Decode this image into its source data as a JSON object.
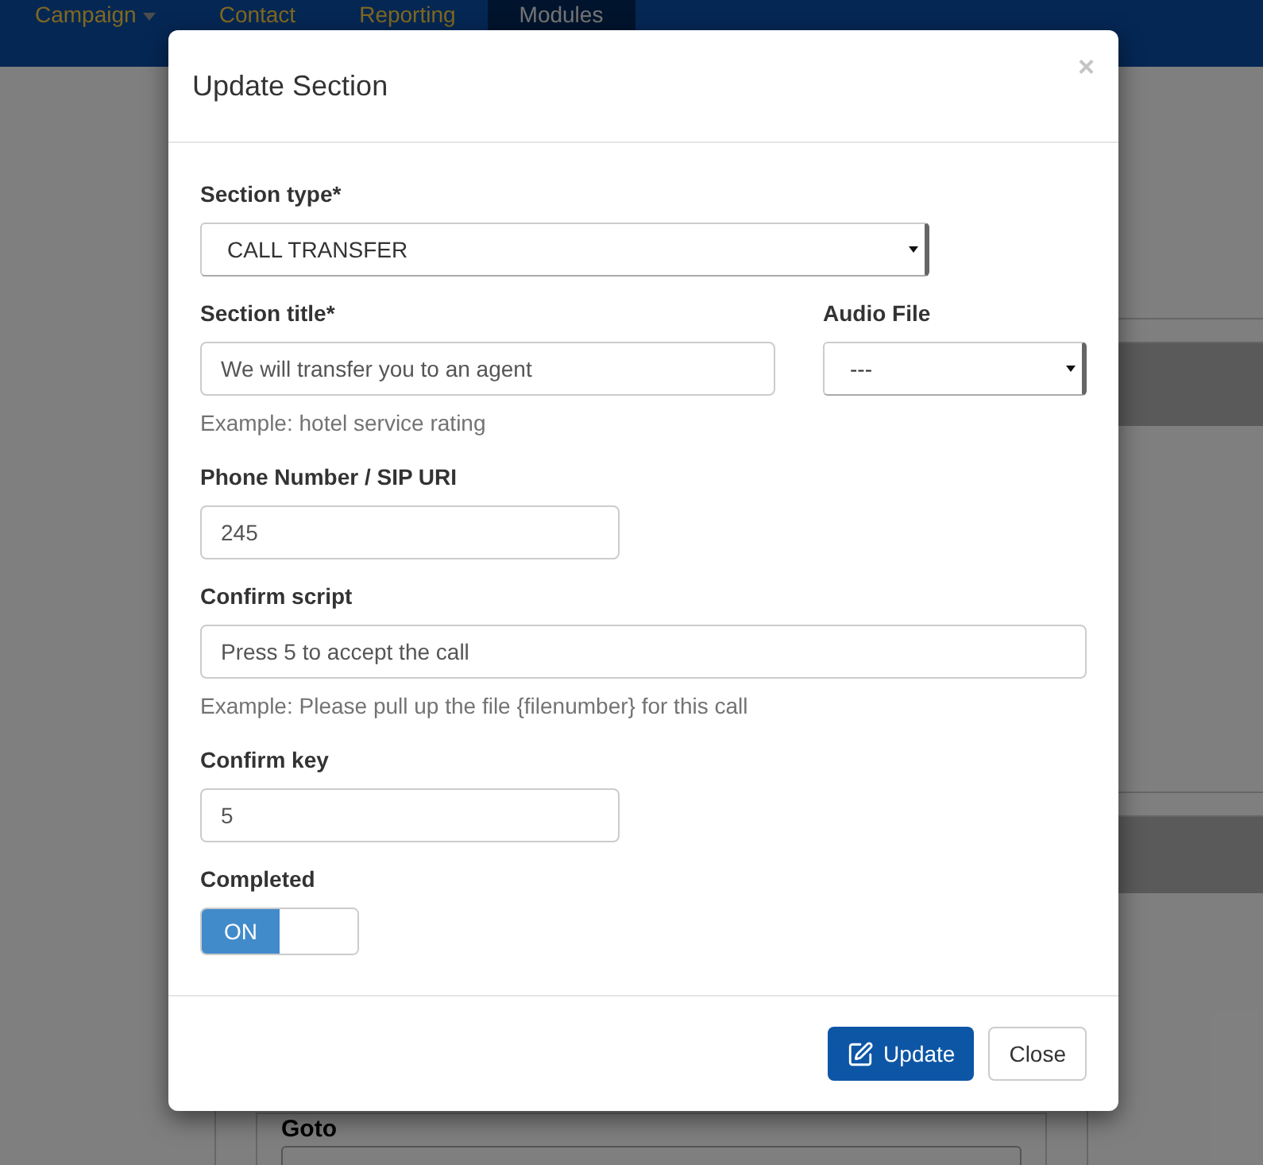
{
  "navbar": {
    "items": [
      {
        "label": "Campaign",
        "has_caret": true,
        "selected": false
      },
      {
        "label": "Contact",
        "has_caret": false,
        "selected": false
      },
      {
        "label": "Reporting",
        "has_caret": false,
        "selected": false
      },
      {
        "label": "Modules",
        "has_caret": false,
        "selected": true
      }
    ]
  },
  "background": {
    "panel_label": "Goto"
  },
  "modal": {
    "title": "Update Section",
    "close": "×",
    "rows": [
      [
        {
          "kind": "select",
          "label": "Section type*",
          "value": "CALL TRANSFER"
        }
      ],
      [
        {
          "kind": "text",
          "label": "Section title*",
          "value": "We will transfer you to an agent",
          "help": "Example: hotel service rating"
        },
        {
          "kind": "select",
          "label": "Audio File",
          "value": "---"
        }
      ],
      [
        {
          "kind": "text",
          "label": "Phone Number / SIP URI",
          "value": "245"
        }
      ],
      [
        {
          "kind": "text",
          "label": "Confirm script",
          "value": "Press 5 to accept the call",
          "help": "Example: Please pull up the file {filenumber} for this call"
        }
      ],
      [
        {
          "kind": "text",
          "label": "Confirm key",
          "value": "5"
        }
      ],
      [
        {
          "kind": "toggle",
          "label": "Completed",
          "on": true,
          "on_label": "ON"
        }
      ]
    ],
    "buttons": [
      {
        "kind": "primary",
        "label": "Update"
      },
      {
        "kind": "default",
        "label": "Close"
      }
    ]
  }
}
